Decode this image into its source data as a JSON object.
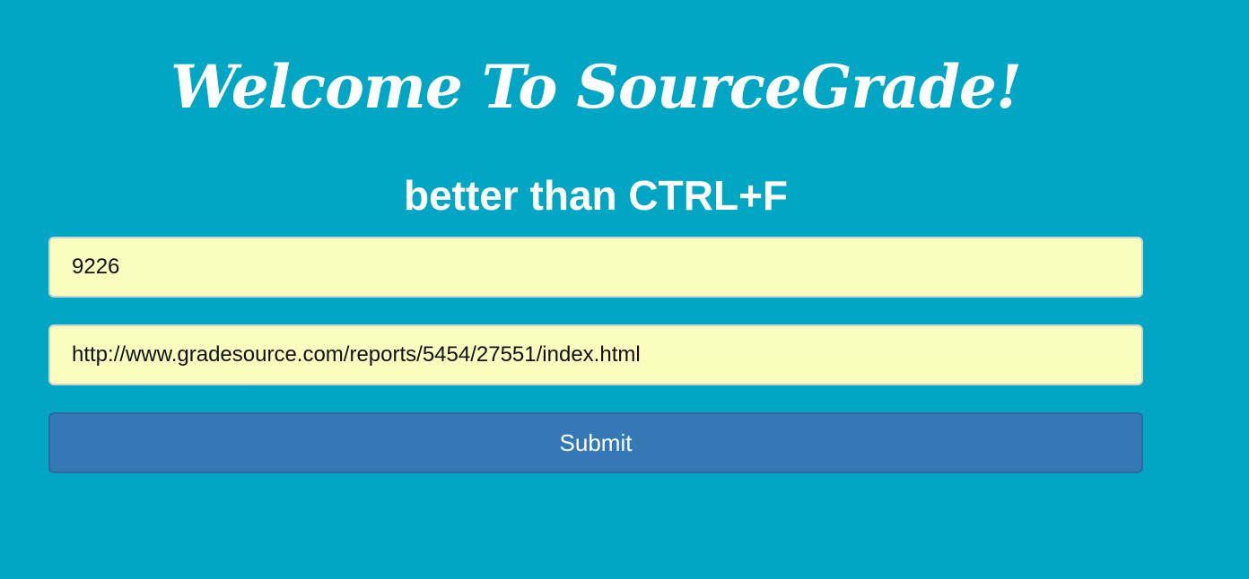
{
  "header": {
    "title": "Welcome To SourceGrade!",
    "tagline": "better than CTRL+F"
  },
  "form": {
    "id_field": {
      "value": "9226"
    },
    "url_field": {
      "value": "http://www.gradesource.com/reports/5454/27551/index.html"
    },
    "submit_label": "Submit"
  },
  "colors": {
    "background": "#00a6c4",
    "input_background": "#f9fdbd",
    "button_background": "#3479b5",
    "text_light": "#ffffff"
  }
}
